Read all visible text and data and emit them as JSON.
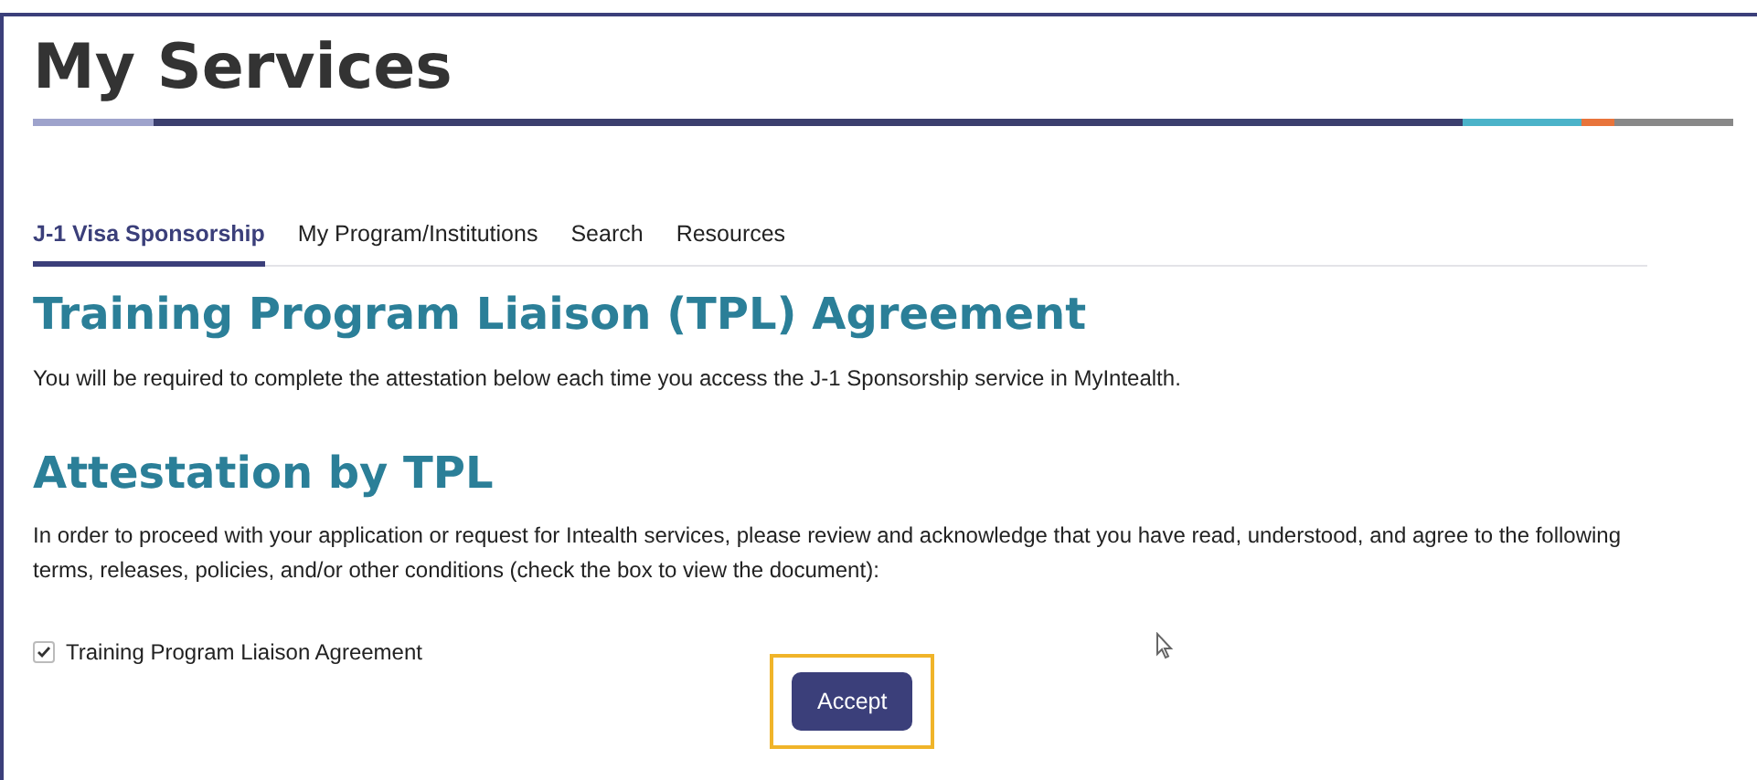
{
  "page_title": "My Services",
  "tabs": [
    {
      "label": "J-1 Visa Sponsorship",
      "selected": true
    },
    {
      "label": "My Program/Institutions",
      "selected": false
    },
    {
      "label": "Search",
      "selected": false
    },
    {
      "label": "Resources",
      "selected": false
    }
  ],
  "heading": "Training Program Liaison (TPL) Agreement",
  "intro": "You will be required to complete the attestation below each time you access the J-1 Sponsorship service in MyIntealth.",
  "attestation_heading": "Attestation by TPL",
  "attestation_text": "In order to proceed with your application or request for Intealth services, please review and acknowledge that you have read, understood, and agree to the following terms, releases, policies, and/or other conditions (check the box to view the document):",
  "agreements": [
    {
      "label": "Training Program Liaison Agreement",
      "checked": true
    }
  ],
  "accept_button": {
    "label": "Accept",
    "focused": true
  }
}
